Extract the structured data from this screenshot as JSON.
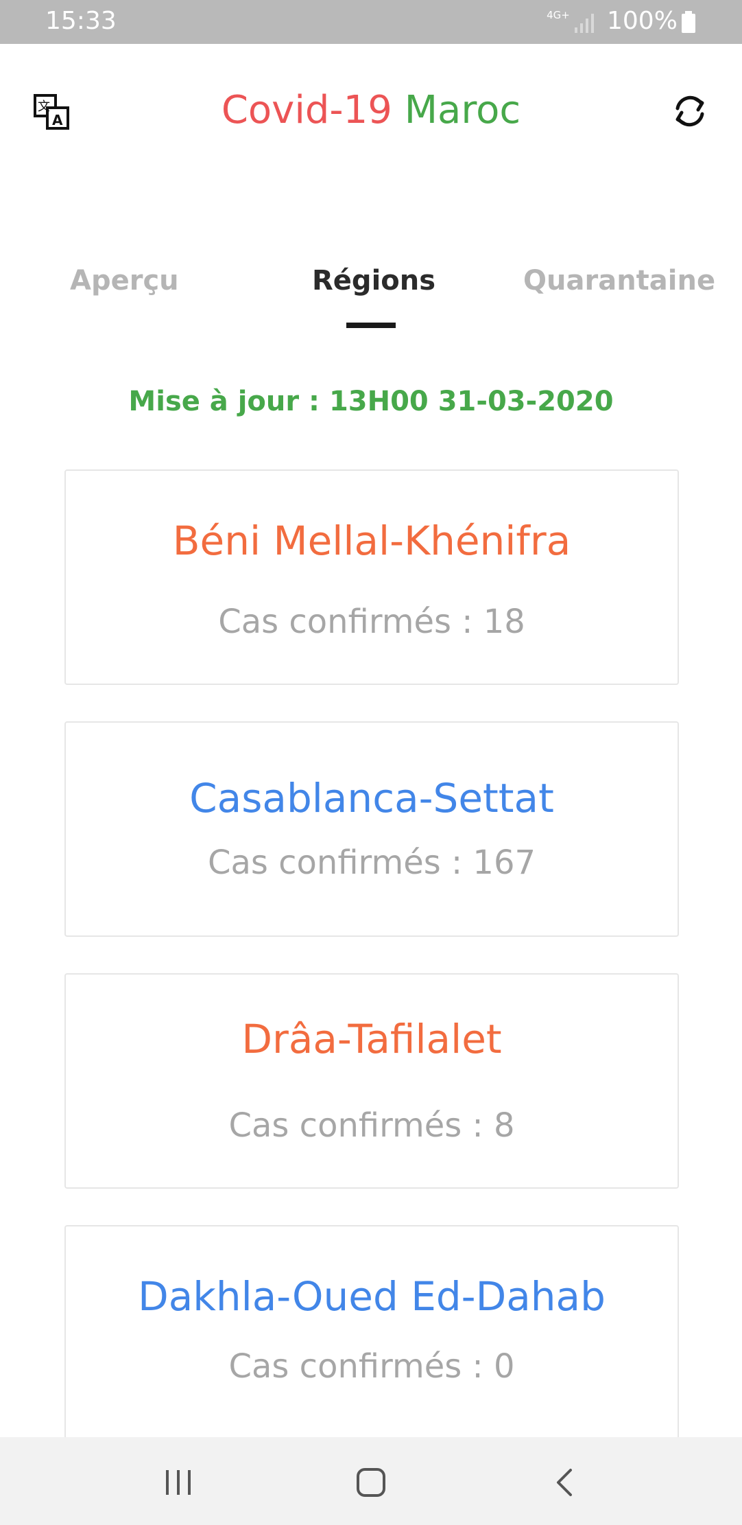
{
  "status_bar": {
    "time": "15:33",
    "network": "4G+",
    "battery": "100%"
  },
  "header": {
    "title_part1": "Covid-19",
    "title_part2": "Maroc",
    "translate_icon": "translate-icon",
    "refresh_icon": "refresh-icon",
    "colors": {
      "title_red": "#ec5455",
      "title_green": "#47a84a"
    }
  },
  "tabs": [
    {
      "label": "Aperçu",
      "active": false
    },
    {
      "label": "Régions",
      "active": true
    },
    {
      "label": "Quarantaine",
      "active": false
    }
  ],
  "update": "Mise à jour : 13H00 31-03-2020",
  "regions": [
    {
      "name": "Béni Mellal-Khénifra",
      "cases": "Cas confirmés : 18",
      "color": "#f26c3f"
    },
    {
      "name": "Casablanca-Settat",
      "cases": "Cas confirmés : 167",
      "color": "#4286e8"
    },
    {
      "name": "Drâa-Tafilalet",
      "cases": "Cas confirmés : 8",
      "color": "#f26c3f"
    },
    {
      "name": "Dakhla-Oued Ed-Dahab",
      "cases": "Cas confirmés : 0",
      "color": "#4286e8"
    }
  ],
  "nav": {
    "recent_icon": "recent-apps-icon",
    "home_icon": "home-icon",
    "back_icon": "back-icon"
  }
}
